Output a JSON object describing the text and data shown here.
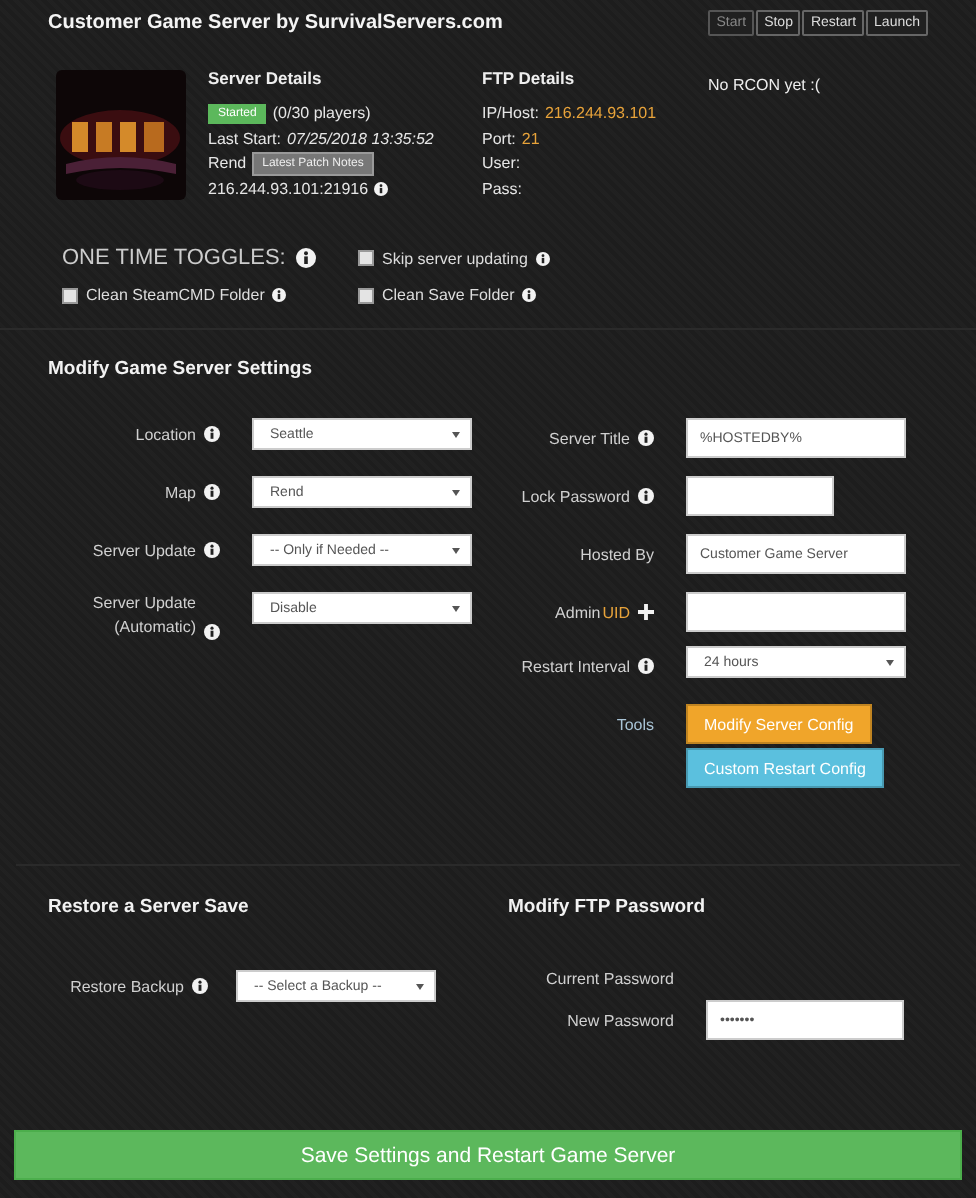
{
  "header": {
    "title": "Customer Game Server by SurvivalServers.com",
    "buttons": [
      {
        "label": "Start",
        "disabled": true
      },
      {
        "label": "Stop",
        "disabled": false
      },
      {
        "label": "Restart",
        "disabled": false
      },
      {
        "label": "Launch",
        "disabled": false
      }
    ]
  },
  "server_details": {
    "title": "Server Details",
    "status": "Started",
    "players": "(0/30 players)",
    "last_start_label": "Last Start:",
    "last_start": "07/25/2018 13:35:52",
    "game": "Rend",
    "patch_notes_button": "Latest Patch Notes",
    "address": "216.244.93.101:21916"
  },
  "ftp_details": {
    "title": "FTP Details",
    "lines": [
      {
        "label": "IP/Host:",
        "value": "216.244.93.101"
      },
      {
        "label": "Port:",
        "value": "21"
      },
      {
        "label": "User:"
      },
      {
        "label": "Pass:"
      }
    ]
  },
  "rcon": "No RCON yet :(",
  "toggles": {
    "title": "ONE TIME TOGGLES:",
    "items": [
      {
        "label": "Skip server updating",
        "checked": false
      },
      {
        "label": "Clean SteamCMD Folder",
        "checked": false
      },
      {
        "label": "Clean Save Folder",
        "checked": false
      }
    ]
  },
  "settings": {
    "title": "Modify Game Server Settings",
    "left": [
      {
        "kind": "select",
        "label": "Location",
        "info": true,
        "value": "Seattle"
      },
      {
        "kind": "select",
        "label": "Map",
        "info": true,
        "value": "Rend"
      },
      {
        "kind": "select",
        "label": "Server Update",
        "info": true,
        "value": "-- Only if Needed --"
      },
      {
        "kind": "select",
        "label": "Server Update (Automatic)",
        "info": true,
        "value": "Disable"
      }
    ],
    "right": [
      {
        "kind": "input",
        "label": "Server Title",
        "info": true,
        "value": "%HOSTEDBY%"
      },
      {
        "kind": "short-input",
        "label": "Lock Password",
        "info": true
      },
      {
        "kind": "input",
        "label": "Hosted By",
        "info": false,
        "value": "Customer Game Server"
      },
      {
        "kind": "input",
        "label": "Admin",
        "highlight": "UID",
        "plus": true,
        "info": false
      },
      {
        "kind": "select",
        "label": "Restart Interval",
        "info": true,
        "value": "24 hours"
      },
      {
        "kind": "tools",
        "label": "Tools",
        "buttons": [
          {
            "label": "Modify Server Config",
            "color": "#f0a52a"
          },
          {
            "label": "Custom Restart Config",
            "color": "#5bc0de"
          }
        ]
      }
    ]
  },
  "restore": {
    "title": "Restore a Server Save",
    "label": "Restore Backup",
    "value": "-- Select a Backup --"
  },
  "ftp_password": {
    "title": "Modify FTP Password",
    "current_label": "Current Password",
    "new_label": "New Password",
    "new_value": "•••••••"
  },
  "save_button": "Save Settings and Restart Game Server"
}
